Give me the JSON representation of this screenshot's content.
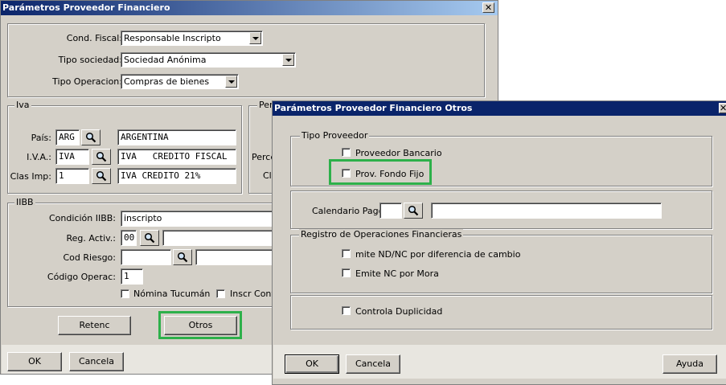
{
  "main": {
    "title": "Parámetros Proveedor Financiero",
    "close": "✕",
    "cond_fiscal_label": "Cond. Fiscal:",
    "cond_fiscal_value": "Responsable Inscripto",
    "tipo_sociedad_label": "Tipo sociedad:",
    "tipo_sociedad_value": "Sociedad Anónima",
    "tipo_operacion_label": "Tipo Operacion:",
    "tipo_operacion_value": "Compras de bienes",
    "iva": {
      "title": "Iva",
      "pais_label": "País:",
      "pais_code": "ARG",
      "pais_desc": "ARGENTINA",
      "iva_label": "I.V.A.:",
      "iva_code": "IVA",
      "iva_desc": "IVA   CREDITO FISCAL",
      "clas_label": "Clas Imp:",
      "clas_code": "1",
      "clas_desc": "IVA CREDITO 21%"
    },
    "right_group": {
      "title": "Per",
      "line1": "Perce",
      "line2": "Cl"
    },
    "iibb": {
      "title": "IIBB",
      "condicion_label": "Condición IIBB:",
      "condicion_value": "inscripto",
      "reg_label": "Reg. Activ.:",
      "reg_code": "00",
      "reg_desc": "",
      "riesgo_label": "Cod Riesgo:",
      "riesgo_code": "",
      "riesgo_desc": "",
      "operac_label": "Código Operac:",
      "operac_value": "1",
      "nomina_label": "Nómina Tucumán",
      "inscr_label": "Inscr Conv"
    },
    "retenc_label": "Retenc",
    "otros_label": "Otros",
    "ok_label": "OK",
    "cancela_label": "Cancela"
  },
  "otros": {
    "title": "Parámetros Proveedor Financiero Otros",
    "close": "✕",
    "tipo_proveedor_title": "Tipo Proveedor",
    "proveedor_bancario": "Proveedor Bancario",
    "fondo_fijo": "Prov. Fondo Fijo",
    "calendario_label": "Calendario Pago:",
    "calendario_code": "",
    "calendario_desc": "",
    "registro_title": "Registro de Operaciones Financieras",
    "emite_nd_nc": "mite ND/NC por diferencia de cambio",
    "emite_nc_mora": "Emite NC por Mora",
    "controla_duplicidad": "Controla Duplicidad",
    "ok_label": "OK",
    "cancela_label": "Cancela",
    "ayuda_label": "Ayuda"
  },
  "colors": {
    "titlebar": "#0a246a",
    "highlight": "#2db04a",
    "window": "#d4d0c8"
  }
}
